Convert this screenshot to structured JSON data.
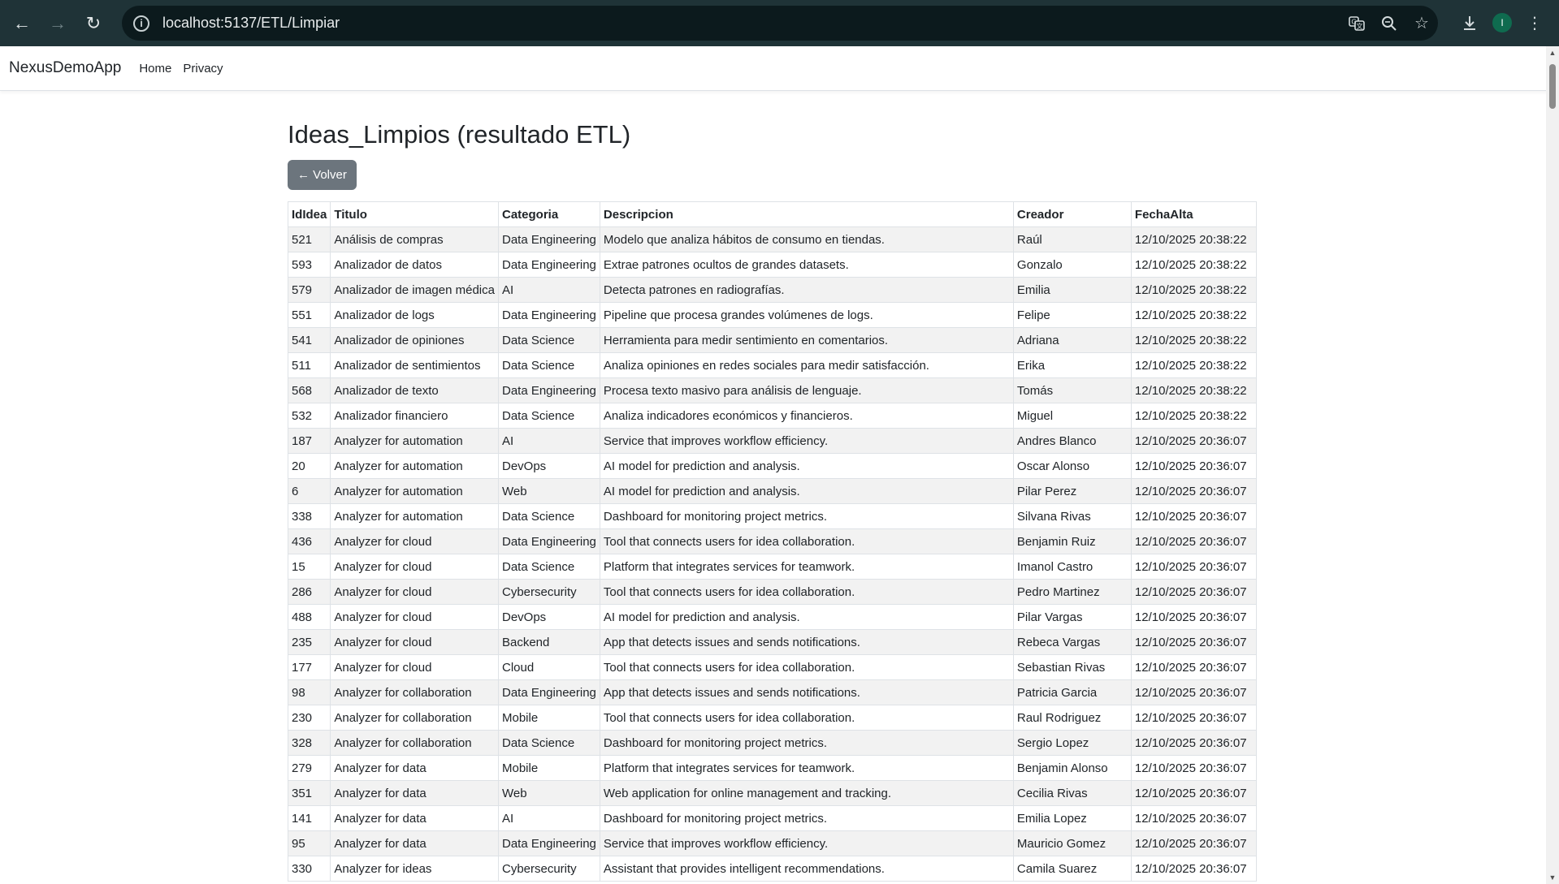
{
  "browser": {
    "url": "localhost:5137/ETL/Limpiar",
    "avatar_letter": "I",
    "icons": [
      "back-arrow-icon",
      "forward-arrow-icon",
      "reload-icon",
      "site-info-icon",
      "translate-icon",
      "zoom-icon",
      "bookmark-star-icon",
      "download-icon",
      "menu-kebab-icon"
    ]
  },
  "navbar": {
    "brand": "NexusDemoApp",
    "links": [
      "Home",
      "Privacy"
    ]
  },
  "page": {
    "title": "Ideas_Limpios (resultado ETL)",
    "back_button": "← Volver"
  },
  "table": {
    "headers": [
      "IdIdea",
      "Titulo",
      "Categoria",
      "Descripcion",
      "Creador",
      "FechaAlta"
    ],
    "rows": [
      [
        "521",
        "Análisis de compras",
        "Data Engineering",
        "Modelo que analiza hábitos de consumo en tiendas.",
        "Raúl",
        "12/10/2025 20:38:22"
      ],
      [
        "593",
        "Analizador de datos",
        "Data Engineering",
        "Extrae patrones ocultos de grandes datasets.",
        "Gonzalo",
        "12/10/2025 20:38:22"
      ],
      [
        "579",
        "Analizador de imagen médica",
        "AI",
        "Detecta patrones en radiografías.",
        "Emilia",
        "12/10/2025 20:38:22"
      ],
      [
        "551",
        "Analizador de logs",
        "Data Engineering",
        "Pipeline que procesa grandes volúmenes de logs.",
        "Felipe",
        "12/10/2025 20:38:22"
      ],
      [
        "541",
        "Analizador de opiniones",
        "Data Science",
        "Herramienta para medir sentimiento en comentarios.",
        "Adriana",
        "12/10/2025 20:38:22"
      ],
      [
        "511",
        "Analizador de sentimientos",
        "Data Science",
        "Analiza opiniones en redes sociales para medir satisfacción.",
        "Erika",
        "12/10/2025 20:38:22"
      ],
      [
        "568",
        "Analizador de texto",
        "Data Engineering",
        "Procesa texto masivo para análisis de lenguaje.",
        "Tomás",
        "12/10/2025 20:38:22"
      ],
      [
        "532",
        "Analizador financiero",
        "Data Science",
        "Analiza indicadores económicos y financieros.",
        "Miguel",
        "12/10/2025 20:38:22"
      ],
      [
        "187",
        "Analyzer for automation",
        "AI",
        "Service that improves workflow efficiency.",
        "Andres Blanco",
        "12/10/2025 20:36:07"
      ],
      [
        "20",
        "Analyzer for automation",
        "DevOps",
        "AI model for prediction and analysis.",
        "Oscar Alonso",
        "12/10/2025 20:36:07"
      ],
      [
        "6",
        "Analyzer for automation",
        "Web",
        "AI model for prediction and analysis.",
        "Pilar Perez",
        "12/10/2025 20:36:07"
      ],
      [
        "338",
        "Analyzer for automation",
        "Data Science",
        "Dashboard for monitoring project metrics.",
        "Silvana Rivas",
        "12/10/2025 20:36:07"
      ],
      [
        "436",
        "Analyzer for cloud",
        "Data Engineering",
        "Tool that connects users for idea collaboration.",
        "Benjamin Ruiz",
        "12/10/2025 20:36:07"
      ],
      [
        "15",
        "Analyzer for cloud",
        "Data Science",
        "Platform that integrates services for teamwork.",
        "Imanol Castro",
        "12/10/2025 20:36:07"
      ],
      [
        "286",
        "Analyzer for cloud",
        "Cybersecurity",
        "Tool that connects users for idea collaboration.",
        "Pedro Martinez",
        "12/10/2025 20:36:07"
      ],
      [
        "488",
        "Analyzer for cloud",
        "DevOps",
        "AI model for prediction and analysis.",
        "Pilar Vargas",
        "12/10/2025 20:36:07"
      ],
      [
        "235",
        "Analyzer for cloud",
        "Backend",
        "App that detects issues and sends notifications.",
        "Rebeca Vargas",
        "12/10/2025 20:36:07"
      ],
      [
        "177",
        "Analyzer for cloud",
        "Cloud",
        "Tool that connects users for idea collaboration.",
        "Sebastian Rivas",
        "12/10/2025 20:36:07"
      ],
      [
        "98",
        "Analyzer for collaboration",
        "Data Engineering",
        "App that detects issues and sends notifications.",
        "Patricia Garcia",
        "12/10/2025 20:36:07"
      ],
      [
        "230",
        "Analyzer for collaboration",
        "Mobile",
        "Tool that connects users for idea collaboration.",
        "Raul Rodriguez",
        "12/10/2025 20:36:07"
      ],
      [
        "328",
        "Analyzer for collaboration",
        "Data Science",
        "Dashboard for monitoring project metrics.",
        "Sergio Lopez",
        "12/10/2025 20:36:07"
      ],
      [
        "279",
        "Analyzer for data",
        "Mobile",
        "Platform that integrates services for teamwork.",
        "Benjamin Alonso",
        "12/10/2025 20:36:07"
      ],
      [
        "351",
        "Analyzer for data",
        "Web",
        "Web application for online management and tracking.",
        "Cecilia Rivas",
        "12/10/2025 20:36:07"
      ],
      [
        "141",
        "Analyzer for data",
        "AI",
        "Dashboard for monitoring project metrics.",
        "Emilia Lopez",
        "12/10/2025 20:36:07"
      ],
      [
        "95",
        "Analyzer for data",
        "Data Engineering",
        "Service that improves workflow efficiency.",
        "Mauricio Gomez",
        "12/10/2025 20:36:07"
      ],
      [
        "330",
        "Analyzer for ideas",
        "Cybersecurity",
        "Assistant that provides intelligent recommendations.",
        "Camila Suarez",
        "12/10/2025 20:36:07"
      ]
    ]
  },
  "colors": {
    "chrome_bg": "#1f3337",
    "omnibox_bg": "#0c1a1d",
    "button_secondary": "#6c757d",
    "stripe": "#f2f2f2",
    "avatar_bg": "#0f6b4f"
  }
}
